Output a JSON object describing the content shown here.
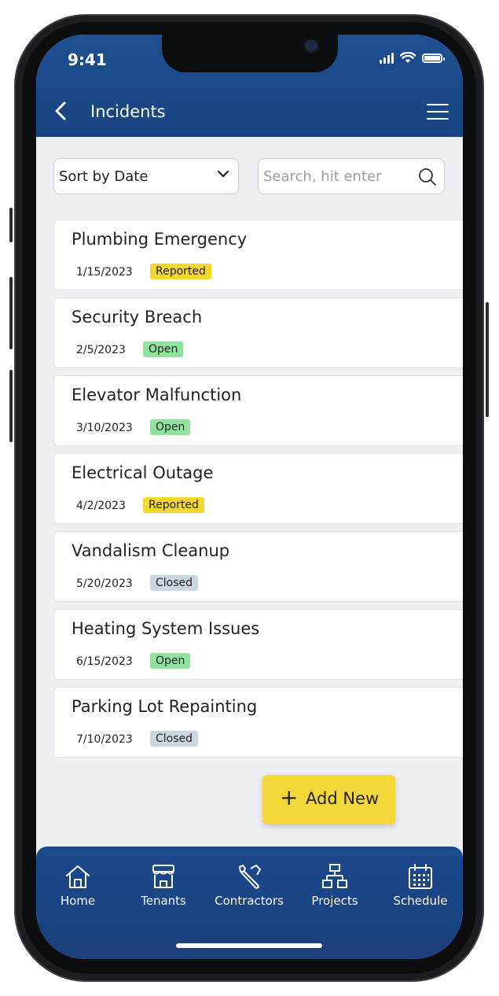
{
  "status_bar": {
    "time": "9:41"
  },
  "header": {
    "title": "Incidents",
    "back_icon": "chevron-left-icon",
    "menu_icon": "hamburger-menu-icon"
  },
  "controls": {
    "sort": {
      "label": "Sort by Date",
      "icon": "chevron-down-icon"
    },
    "search": {
      "placeholder": "Search, hit enter",
      "value": "",
      "icon": "search-icon"
    }
  },
  "incidents": [
    {
      "title": "Plumbing Emergency",
      "date": "1/15/2023",
      "status": "Reported"
    },
    {
      "title": "Security Breach",
      "date": "2/5/2023",
      "status": "Open"
    },
    {
      "title": "Elevator Malfunction",
      "date": "3/10/2023",
      "status": "Open"
    },
    {
      "title": "Electrical Outage",
      "date": "4/2/2023",
      "status": "Reported"
    },
    {
      "title": "Vandalism Cleanup",
      "date": "5/20/2023",
      "status": "Closed"
    },
    {
      "title": "Heating System Issues",
      "date": "6/15/2023",
      "status": "Open"
    },
    {
      "title": "Parking Lot Repainting",
      "date": "7/10/2023",
      "status": "Closed"
    }
  ],
  "status_colors": {
    "Reported": "#f3d72e",
    "Open": "#8fe39c",
    "Closed": "#cdd6e0"
  },
  "add_button": {
    "label": "Add New",
    "icon": "plus-icon"
  },
  "tabbar": {
    "tabs": [
      {
        "label": "Home",
        "icon": "home-icon"
      },
      {
        "label": "Tenants",
        "icon": "storefront-icon"
      },
      {
        "label": "Contractors",
        "icon": "wrench-icon"
      },
      {
        "label": "Projects",
        "icon": "hierarchy-icon"
      },
      {
        "label": "Schedule",
        "icon": "calendar-icon"
      }
    ]
  },
  "colors": {
    "brand_blue": "#1d4f91",
    "accent_yellow": "#f4d83a"
  }
}
